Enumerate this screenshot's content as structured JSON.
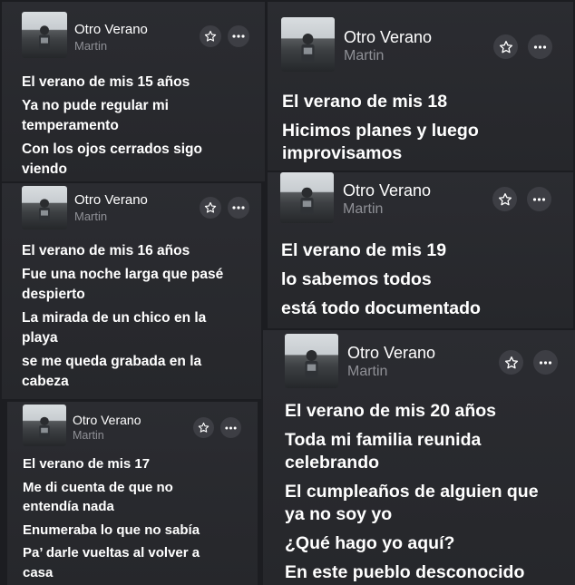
{
  "cards": [
    {
      "title": "Otro Verano",
      "artist": "Martin",
      "star_icon": "star-outline-icon",
      "more_icon": "ellipsis-icon",
      "lines": [
        "El verano de mis 15 años",
        "Ya no pude regular mi temperamento",
        "Con los ojos cerrados sigo viendo"
      ]
    },
    {
      "title": "Otro Verano",
      "artist": "Martin",
      "star_icon": "star-outline-icon",
      "more_icon": "ellipsis-icon",
      "lines": [
        "El verano de mis 16 años",
        "Fue una noche larga que pasé despierto",
        "La mirada de un chico en la playa",
        "se me queda grabada en la cabeza"
      ]
    },
    {
      "title": "Otro Verano",
      "artist": "Martin",
      "star_icon": "star-outline-icon",
      "more_icon": "ellipsis-icon",
      "lines": [
        "El verano de mis 17",
        "Me di cuenta de que no entendía nada",
        "Enumeraba lo que no sabía",
        "Pa’ darle vueltas al volver a casa"
      ]
    },
    {
      "title": "Otro Verano",
      "artist": "Martin",
      "star_icon": "star-outline-icon",
      "more_icon": "ellipsis-icon",
      "lines": [
        "El verano de mis 18",
        "Hicimos planes y luego improvisamos"
      ]
    },
    {
      "title": "Otro Verano",
      "artist": "Martin",
      "star_icon": "star-outline-icon",
      "more_icon": "ellipsis-icon",
      "lines": [
        "El verano de mis 19",
        "lo sabemos todos",
        "está todo documentado"
      ]
    },
    {
      "title": "Otro Verano",
      "artist": "Martin",
      "star_icon": "star-outline-icon",
      "more_icon": "ellipsis-icon",
      "lines": [
        "El verano de mis 20 años",
        "Toda mi familia reunida celebrando",
        "El cumpleaños de alguien que ya no soy yo",
        "¿Qué hago yo aquí?",
        "En este pueblo desconocido"
      ]
    }
  ]
}
